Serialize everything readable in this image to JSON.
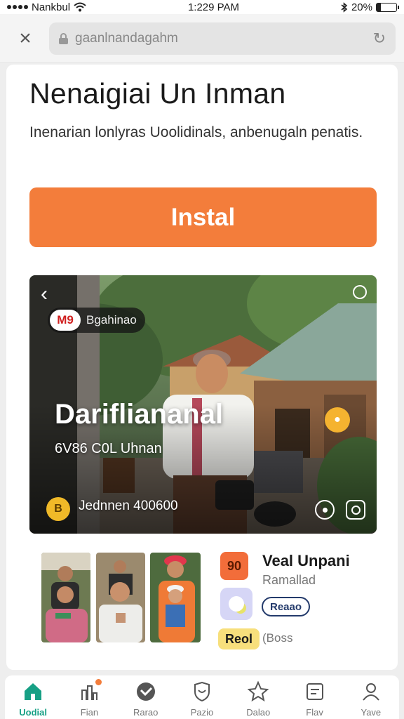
{
  "status_bar": {
    "carrier": "Nankbul",
    "time": "1:229 PAM",
    "battery": "20%",
    "battery_level": 0.2
  },
  "browser": {
    "url": "gaanlnandagahm"
  },
  "app": {
    "title": "Nenaigiai Un Inman",
    "subtitle": "Inenarian lonlyras Uoolidinals, anbenugaln penatis.",
    "install_label": "Instal"
  },
  "hero": {
    "brand_logo": "M9",
    "brand_name": "Bgahinao",
    "headline": "Darifliananal",
    "subline": "6V86 C0L Uhnan",
    "price_icon": "B",
    "price_text": "Jednnen 400600"
  },
  "details": {
    "icon_a_text": "90",
    "name": "Veal Unpani",
    "developer": "Ramallad",
    "badge": "Reaao",
    "tag": "Reol",
    "size": "(Boss"
  },
  "nav": {
    "items": [
      {
        "label": "Uodial",
        "icon": "home-icon",
        "active": true
      },
      {
        "label": "Fian",
        "icon": "chart-icon"
      },
      {
        "label": "Rarao",
        "icon": "checkmark-icon"
      },
      {
        "label": "Pazio",
        "icon": "shield-icon"
      },
      {
        "label": "Dalao",
        "icon": "star-icon"
      },
      {
        "label": "Flav",
        "icon": "list-icon"
      },
      {
        "label": "Yave",
        "icon": "profile-icon"
      }
    ]
  },
  "colors": {
    "accent": "#f37d3b",
    "active_nav": "#17a085",
    "badge_border": "#233a6b"
  }
}
